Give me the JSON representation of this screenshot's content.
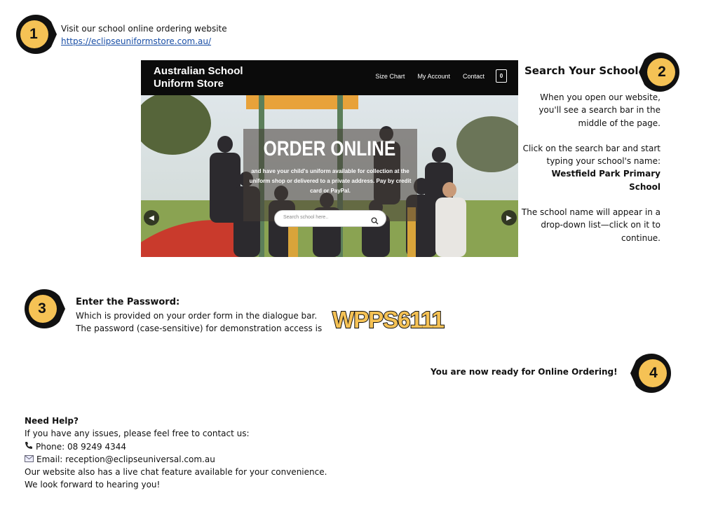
{
  "step1": {
    "number": "1",
    "text": "Visit our school online ordering website",
    "link": "https://eclipseuniformstore.com.au/"
  },
  "website": {
    "brand": "Australian School\nUniform Store",
    "nav": [
      "Size Chart",
      "My Account",
      "Contact"
    ],
    "cart_count": "0",
    "hero_title": "ORDER ONLINE",
    "hero_subtitle": "and have your child's uniform available for collection at the uniform shop or delivered to a private address. Pay by credit card or PayPal.",
    "search_placeholder": "Search school here.."
  },
  "step2": {
    "number": "2",
    "title": "Search Your School",
    "p1": "When you open our website, you'll see a search bar in the middle of the page.",
    "p2_prefix": "Click on the search bar and start typing your school's name:",
    "p2_school": "Westfield Park Primary School",
    "p3": "The school name will appear in a drop-down list—click on it to continue."
  },
  "step3": {
    "number": "3",
    "title": "Enter the Password:",
    "line1": "Which is provided on your order form in the dialogue bar.",
    "line2": "The password (case-sensitive) for demonstration access is",
    "password": "WPPS6111"
  },
  "step4": {
    "number": "4",
    "text": "You are now ready for Online Ordering!"
  },
  "help": {
    "title": "Need Help?",
    "intro": "If you have any issues, please feel free to contact us:",
    "phone": "Phone: 08 9249 4344",
    "email": "Email: reception@eclipseuniversal.com.au",
    "chat": "Our website also has a live chat feature available for your convenience.",
    "closing": "We look forward to hearing you!"
  },
  "colors": {
    "badge_fill": "#F5C255",
    "badge_ring": "#111111",
    "password_fill": "#F5C255"
  }
}
